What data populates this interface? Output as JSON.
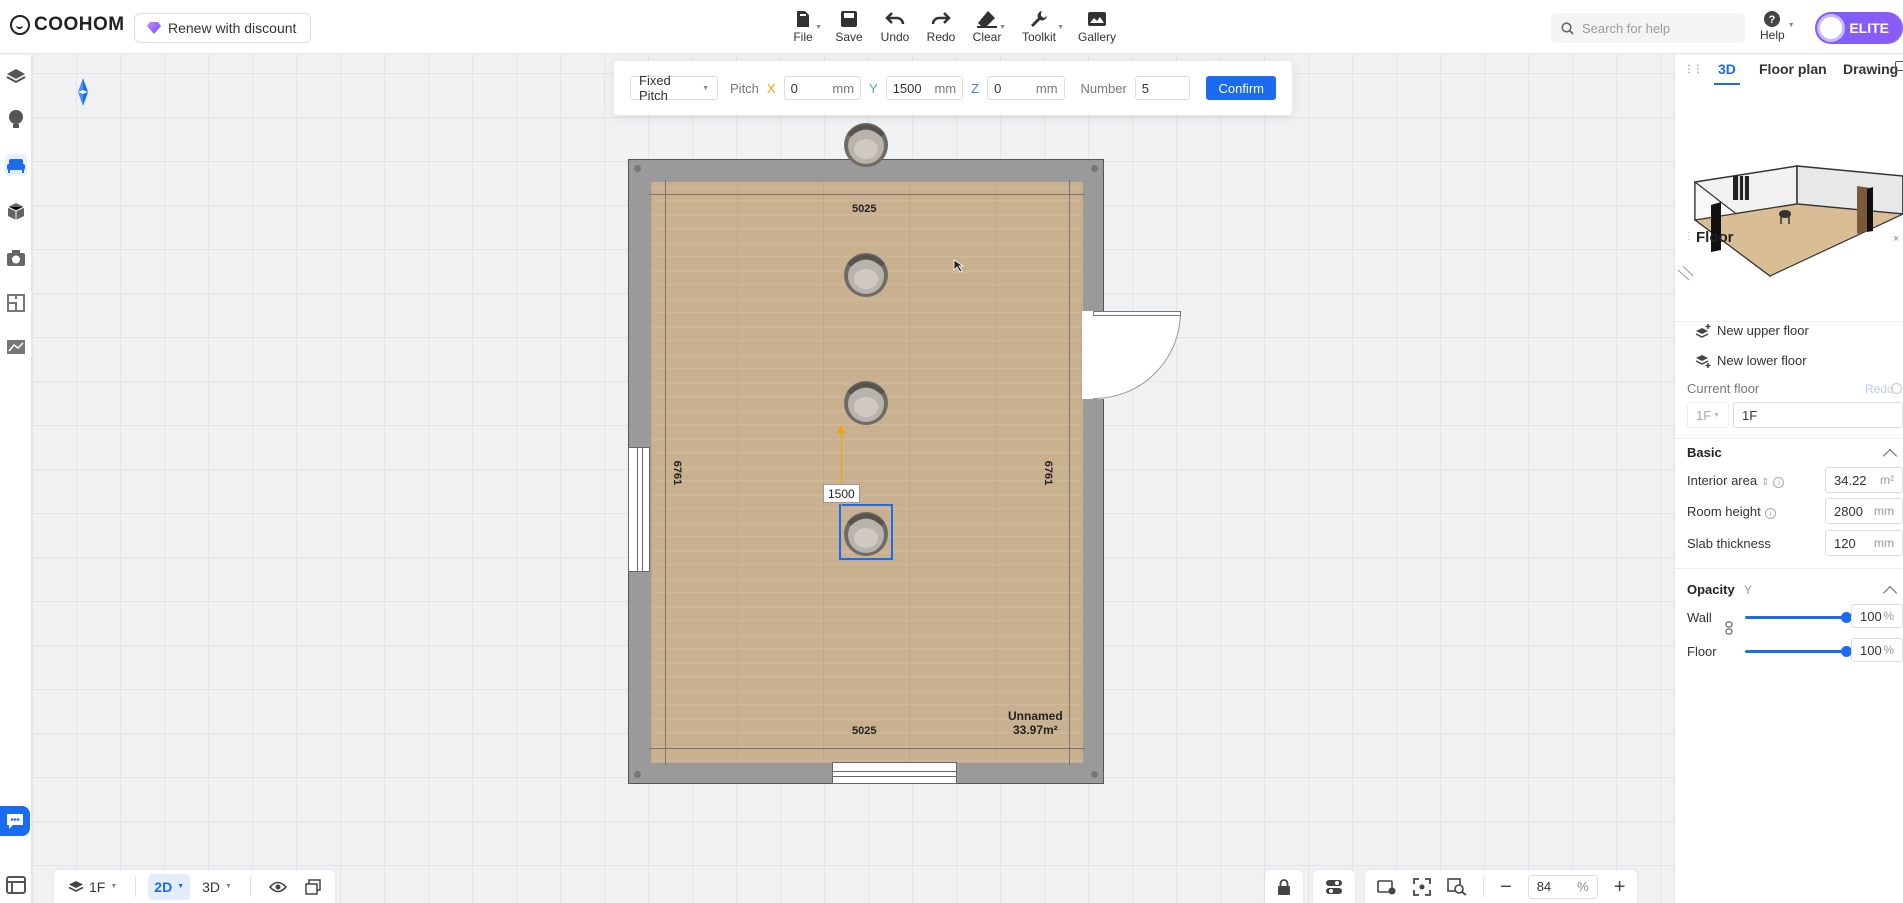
{
  "app": {
    "brand": "COOHOM",
    "renew_label": "Renew with discount"
  },
  "toolbar": {
    "file": "File",
    "save": "Save",
    "undo": "Undo",
    "redo": "Redo",
    "clear": "Clear",
    "toolkit": "Toolkit",
    "gallery": "Gallery"
  },
  "search": {
    "placeholder": "Search for help"
  },
  "help": {
    "label": "Help"
  },
  "elite": {
    "label": "ELITE"
  },
  "pitch": {
    "mode": "Fixed Pitch",
    "pitch_label": "Pitch",
    "x_label": "X",
    "x_value": "0",
    "x_unit": "mm",
    "y_label": "Y",
    "y_value": "1500",
    "y_unit": "mm",
    "z_label": "Z",
    "z_value": "0",
    "z_unit": "mm",
    "number_label": "Number",
    "number_value": "5",
    "confirm": "Confirm"
  },
  "plan": {
    "dim_top": "5025",
    "dim_bottom": "5025",
    "dim_left": "6761",
    "dim_right": "6761",
    "offset_badge": "1500",
    "room_name": "Unnamed",
    "room_area": "33.97m²"
  },
  "bottom": {
    "floor": "1F",
    "mode_2d": "2D",
    "mode_3d": "3D",
    "zoom_value": "84",
    "zoom_unit": "%"
  },
  "right_panel": {
    "tabs": {
      "t3d": "3D",
      "floor_plan": "Floor plan",
      "drawing": "Drawing"
    },
    "floor_title": "Floor",
    "new_upper": "New upper floor",
    "new_lower": "New lower floor",
    "current_floor_label": "Current floor",
    "redo_label": "Redo",
    "floor_select": "1F",
    "floor_name": "1F",
    "basic_title": "Basic",
    "interior_area_label": "Interior area",
    "interior_area_value": "34.22",
    "interior_area_unit": "m²",
    "room_height_label": "Room height",
    "room_height_value": "2800",
    "room_height_unit": "mm",
    "slab_label": "Slab thickness",
    "slab_value": "120",
    "slab_unit": "mm",
    "opacity_title": "Opacity",
    "opacity_hint": "Y",
    "wall_label": "Wall",
    "wall_value": "100",
    "wall_unit": "%",
    "wall_level": 1.0,
    "floor_label": "Floor",
    "floor_value": "100",
    "floor_unit": "%",
    "floor_level": 1.0
  },
  "colors": {
    "accent": "#1a6bf0",
    "elite": "#7b5cff",
    "x_axis": "#f0a000",
    "y_axis": "#3bbf6b",
    "z_axis": "#3f7df5"
  }
}
